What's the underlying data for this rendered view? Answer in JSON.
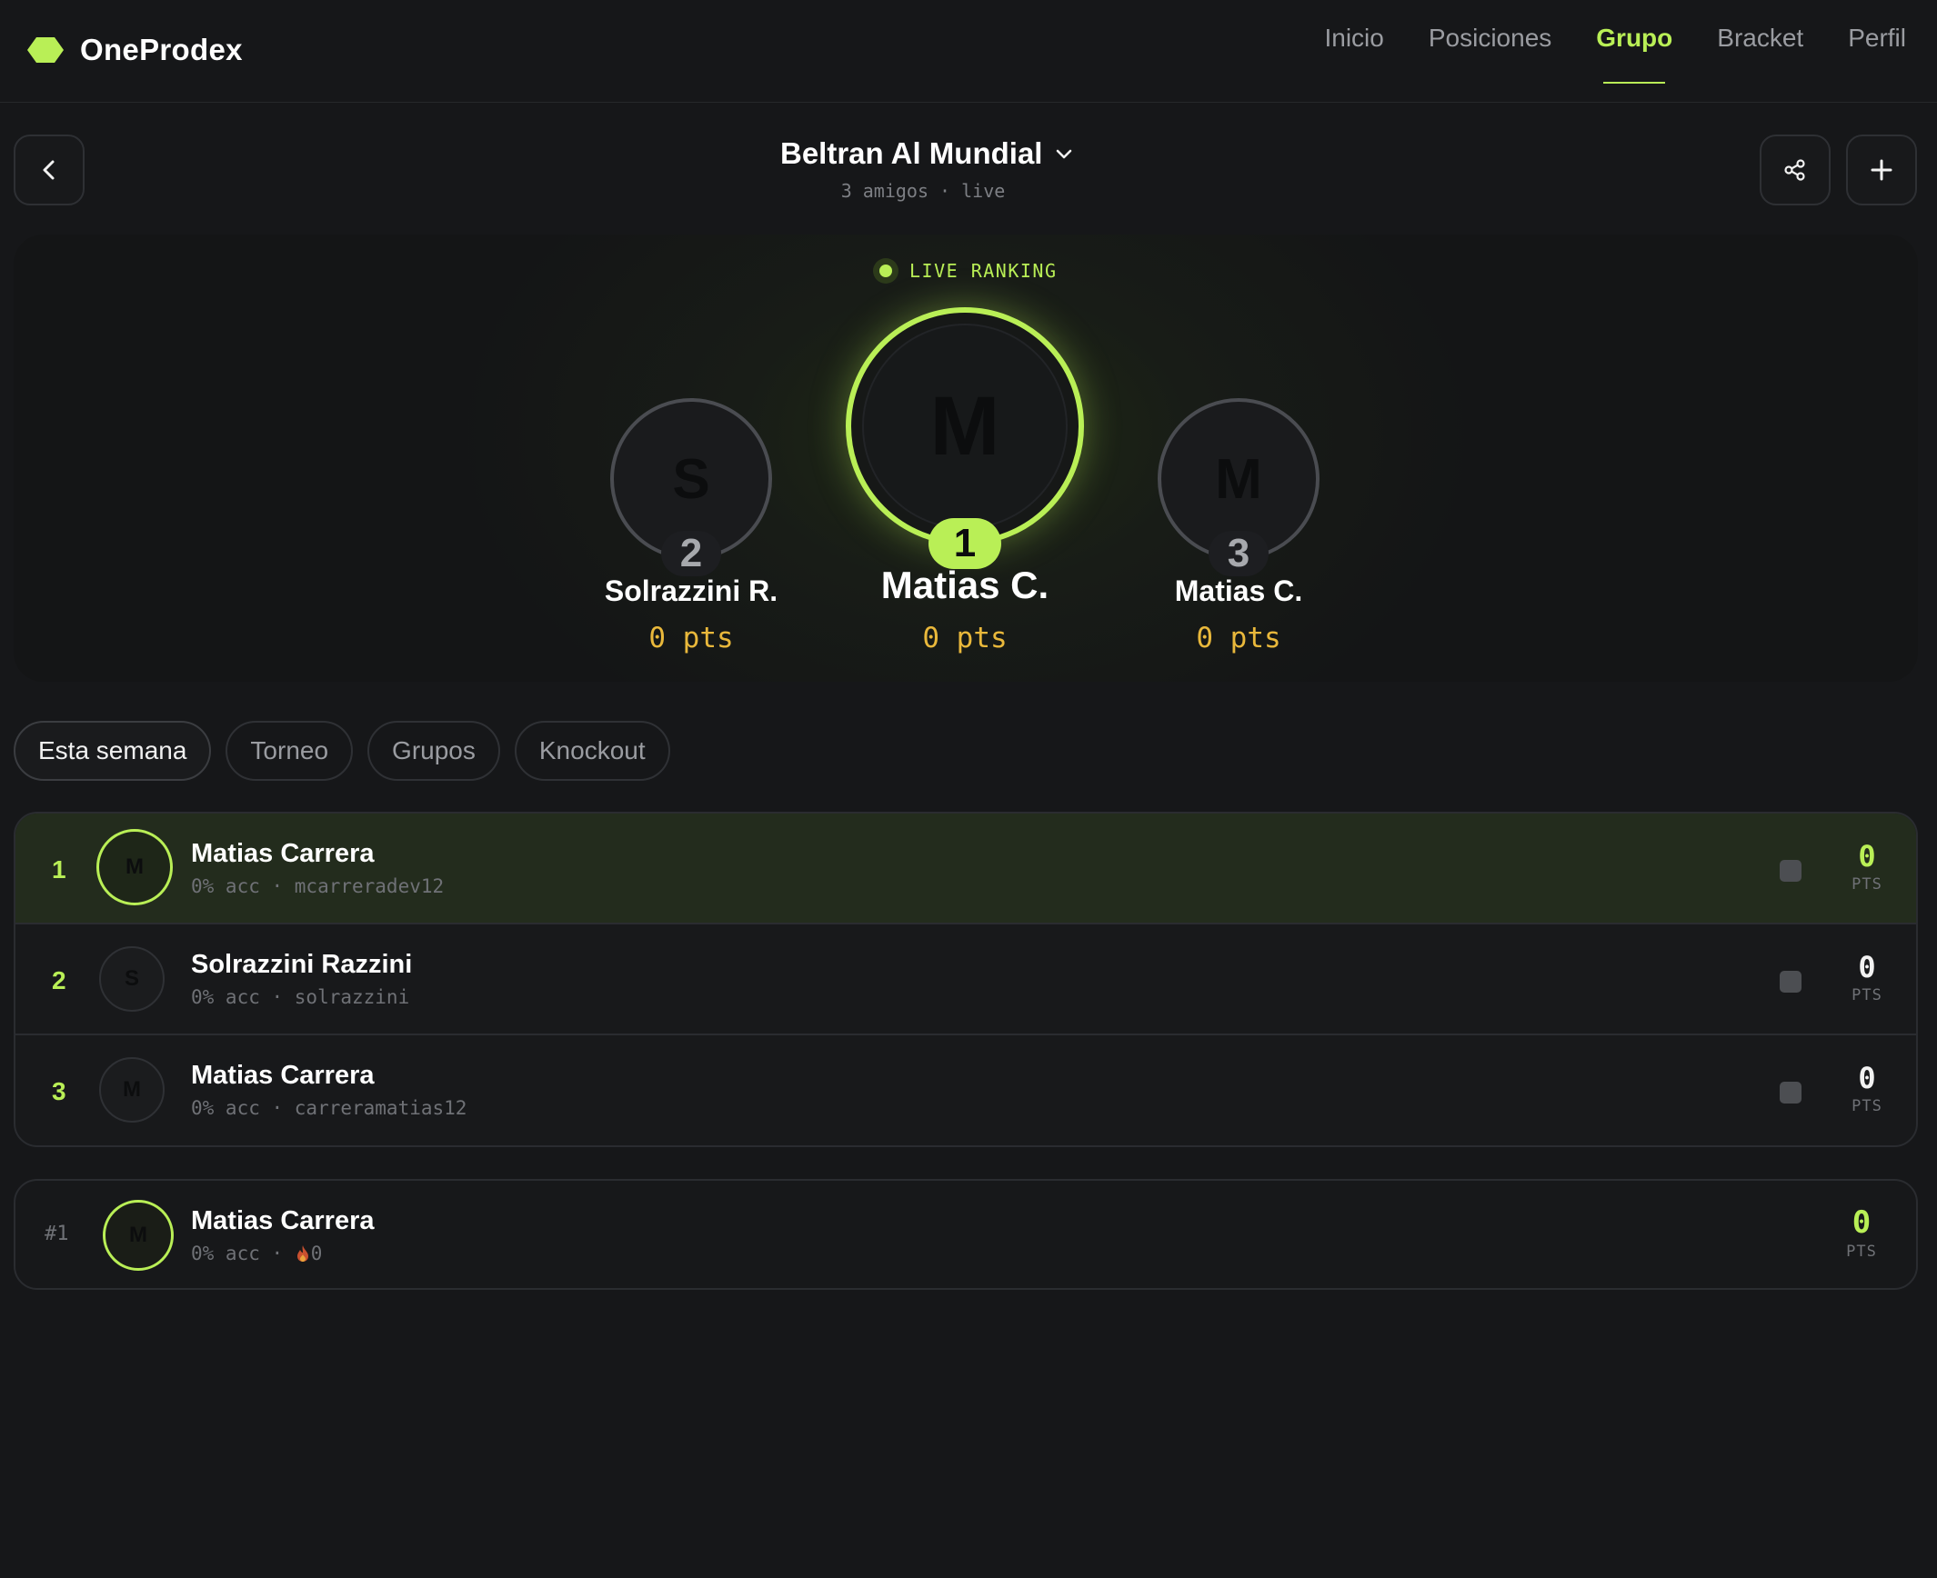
{
  "brand": {
    "name": "OneProdex",
    "logo_color": "#b9ef56"
  },
  "nav": {
    "items": [
      {
        "label": "Inicio",
        "active": false
      },
      {
        "label": "Posiciones",
        "active": false
      },
      {
        "label": "Grupo",
        "active": true
      },
      {
        "label": "Bracket",
        "active": false
      },
      {
        "label": "Perfil",
        "active": false
      }
    ]
  },
  "header": {
    "group_name": "Beltran Al Mundial",
    "subtitle": "3 amigos · live",
    "icons": {
      "back": "chevron-left-icon",
      "share": "share-icon",
      "add": "plus-icon",
      "dropdown": "chevron-down-icon"
    }
  },
  "podium": {
    "live_label": "LIVE RANKING",
    "first": {
      "initial": "M",
      "rank": "1",
      "name": "Matias C.",
      "pts": "0 pts"
    },
    "second": {
      "initial": "S",
      "rank": "2",
      "name": "Solrazzini R.",
      "pts": "0 pts"
    },
    "third": {
      "initial": "M",
      "rank": "3",
      "name": "Matias C.",
      "pts": "0 pts"
    }
  },
  "tabs": [
    {
      "label": "Esta semana",
      "active": true
    },
    {
      "label": "Torneo",
      "active": false
    },
    {
      "label": "Grupos",
      "active": false
    },
    {
      "label": "Knockout",
      "active": false
    }
  ],
  "ranking": {
    "rows": [
      {
        "rank": "1",
        "initial": "M",
        "name": "Matias Carrera",
        "meta": "0% acc · mcarreradev12",
        "pts": "0",
        "pts_label": "PTS"
      },
      {
        "rank": "2",
        "initial": "S",
        "name": "Solrazzini Razzini",
        "meta": "0% acc · solrazzini",
        "pts": "0",
        "pts_label": "PTS"
      },
      {
        "rank": "3",
        "initial": "M",
        "name": "Matias Carrera",
        "meta": "0% acc · carreramatias12",
        "pts": "0",
        "pts_label": "PTS"
      }
    ]
  },
  "me": {
    "rank": "#1",
    "initial": "M",
    "name": "Matias Carrera",
    "meta_acc": "0% acc · ",
    "streak_icon": "fire-icon",
    "streak": "0",
    "pts": "0",
    "pts_label": "PTS"
  },
  "colors": {
    "accent": "#b9ef56",
    "points": "#e9b83b",
    "background": "#161719"
  }
}
